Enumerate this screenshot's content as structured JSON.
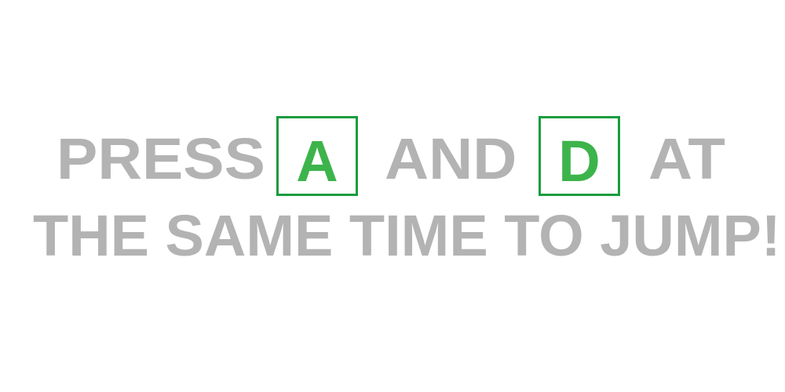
{
  "instruction": {
    "word_press": "PRESS",
    "key_a": "A",
    "word_and": "AND",
    "key_d": "D",
    "word_at": "AT",
    "line2": "THE SAME TIME TO JUMP!"
  },
  "colors": {
    "text": "#b3b3b3",
    "key_border": "#1a9c3e",
    "key_letter": "#3cb44b",
    "background": "#ffffff"
  }
}
